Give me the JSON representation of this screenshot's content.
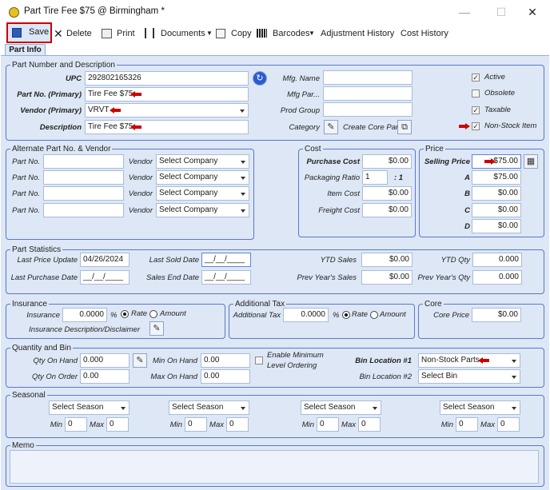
{
  "window": {
    "title": "Part Tire Fee $75 @ Birmingham *",
    "minimize": "—",
    "maximize": "☐",
    "close": "✕"
  },
  "toolbar": {
    "save": "Save",
    "delete": "Delete",
    "print": "Print",
    "documents": "Documents",
    "copy": "Copy",
    "barcodes": "Barcodes",
    "adjustment_history": "Adjustment History",
    "cost_history": "Cost History"
  },
  "tabs": {
    "part_info": "Part Info"
  },
  "part_number": {
    "legend": "Part Number and Description",
    "upc_label": "UPC",
    "upc": "292802165326",
    "primary_label": "Part No. (Primary)",
    "primary": "Tire Fee $75",
    "vendor_label": "Vendor (Primary)",
    "vendor": "VRVT",
    "description_label": "Description",
    "description": "Tire Fee $75",
    "mfg_name_label": "Mfg. Name",
    "mfg_name": "",
    "mfg_part_label": "Mfg Par...",
    "mfg_part": "",
    "prod_group_label": "Prod Group",
    "prod_group": "",
    "category_label": "Category",
    "category": "",
    "create_core_label": "Create Core Part",
    "active_label": "Active",
    "active": true,
    "obsolete_label": "Obsolete",
    "obsolete": false,
    "taxable_label": "Taxable",
    "taxable": true,
    "nonstock_label": "Non-Stock Item",
    "nonstock": true
  },
  "alternate": {
    "legend": "Alternate Part No. & Vendor",
    "part_label": "Part No.",
    "vendor_label": "Vendor",
    "rows": [
      {
        "part": "",
        "vendor": "Select Company"
      },
      {
        "part": "",
        "vendor": "Select Company"
      },
      {
        "part": "",
        "vendor": "Select Company"
      },
      {
        "part": "",
        "vendor": "Select Company"
      }
    ]
  },
  "cost": {
    "legend": "Cost",
    "purchase_label": "Purchase Cost",
    "purchase": "$0.00",
    "packaging_label": "Packaging Ratio",
    "packaging": "1",
    "packaging_suffix": ": 1",
    "item_label": "Item Cost",
    "item": "$0.00",
    "freight_label": "Freight Cost",
    "freight": "$0.00"
  },
  "price": {
    "legend": "Price",
    "selling_label": "Selling Price",
    "selling": "$75.00",
    "a_label": "A",
    "a": "$75.00",
    "b_label": "B",
    "b": "$0.00",
    "c_label": "C",
    "c": "$0.00",
    "d_label": "D",
    "d": "$0.00"
  },
  "stats": {
    "legend": "Part Statistics",
    "last_price_update_label": "Last Price Update",
    "last_price_update": "04/26/2024",
    "last_sold_label": "Last Sold Date",
    "last_sold": "__/__/____",
    "ytd_sales_label": "YTD Sales",
    "ytd_sales": "$0.00",
    "ytd_qty_label": "YTD Qty",
    "ytd_qty": "0.000",
    "last_purchase_label": "Last Purchase Date",
    "last_purchase": "__/__/____",
    "sales_end_label": "Sales End Date",
    "sales_end": "__/__/____",
    "prev_sales_label": "Prev Year's Sales",
    "prev_sales": "$0.00",
    "prev_qty_label": "Prev Year's Qty",
    "prev_qty": "0.000"
  },
  "insurance": {
    "legend": "Insurance",
    "insurance_label": "Insurance",
    "insurance": "0.0000",
    "pct": "%",
    "rate": "Rate",
    "amount": "Amount",
    "desc_label": "Insurance Description/Disclaimer"
  },
  "tax": {
    "legend": "Additional Tax",
    "tax_label": "Additional Tax",
    "tax": "0.0000",
    "pct": "%",
    "rate": "Rate",
    "amount": "Amount"
  },
  "core": {
    "legend": "Core",
    "price_label": "Core Price",
    "price": "$0.00"
  },
  "qty": {
    "legend": "Quantity and Bin",
    "on_hand_label": "Qty On Hand",
    "on_hand": "0.000",
    "on_order_label": "Qty On Order",
    "on_order": "0.00",
    "min_label": "Min On Hand",
    "min": "0.00",
    "max_label": "Max On Hand",
    "max": "0.00",
    "min_order_label1": "Enable Minimum",
    "min_order_label2": "Level Ordering",
    "bin1_label": "Bin Location #1",
    "bin1": "Non-Stock Parts",
    "bin2_label": "Bin Location #2",
    "bin2": "Select Bin"
  },
  "seasonal": {
    "legend": "Seasonal",
    "min_label": "Min",
    "max_label": "Max",
    "items": [
      {
        "season": "Select Season",
        "min": "0",
        "max": "0"
      },
      {
        "season": "Select Season",
        "min": "0",
        "max": "0"
      },
      {
        "season": "Select Season",
        "min": "0",
        "max": "0"
      },
      {
        "season": "Select Season",
        "min": "0",
        "max": "0"
      }
    ]
  },
  "memo": {
    "legend": "Memo",
    "text": ""
  },
  "colors": {
    "accent": "#5a78c8",
    "panel": "#dde7f6",
    "highlight": "#cc0000"
  }
}
